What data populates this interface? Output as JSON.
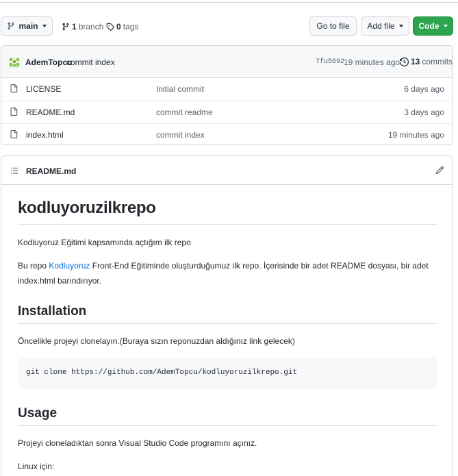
{
  "toolbar": {
    "branch_button": "main",
    "branches_count": "1",
    "branches_label": "branch",
    "tags_count": "0",
    "tags_label": "tags",
    "go_to_file": "Go to file",
    "add_file": "Add file",
    "code": "Code",
    "code_color": "#2da44e"
  },
  "commit": {
    "author": "AdemTopcu",
    "message": "commit index",
    "sha": "7fu5692",
    "time": "19 minutes ago",
    "commits_count": "13",
    "commits_label": "commits"
  },
  "files": [
    {
      "name": "LICENSE",
      "message": "Initial commit",
      "age": "6 days ago"
    },
    {
      "name": "README.md",
      "message": "commit readme",
      "age": "3 days ago"
    },
    {
      "name": "index.html",
      "message": "commit index",
      "age": "19 minutes ago"
    }
  ],
  "readme": {
    "filename": "README.md",
    "title": "kodluyoruzilkrepo",
    "intro": "Kodluyoruz Eğitimi kapsamında açtığım ilk repo",
    "desc_pre": "Bu repo ",
    "desc_link": "Kodluyoruz",
    "desc_post": " Front-End Eğitiminde oluşturduğumuz ilk repo. İçerisinde bir adet README dosyası, bir adet",
    "desc_line2": "index.html barındırıyor.",
    "installation_heading": "Installation",
    "installation_text": "Öncelikle projeyi clonelayın.(Buraya sızın reponuzdan aldığınız link gelecek)",
    "clone_command": "git clone https://github.com/AdemTopcu/kodluyoruzilkrepo.git",
    "usage_heading": "Usage",
    "usage_text": "Projeyi cloneladıktan sonra Visual Studio Code programını açınız.",
    "linux_text": "Linux için:"
  }
}
